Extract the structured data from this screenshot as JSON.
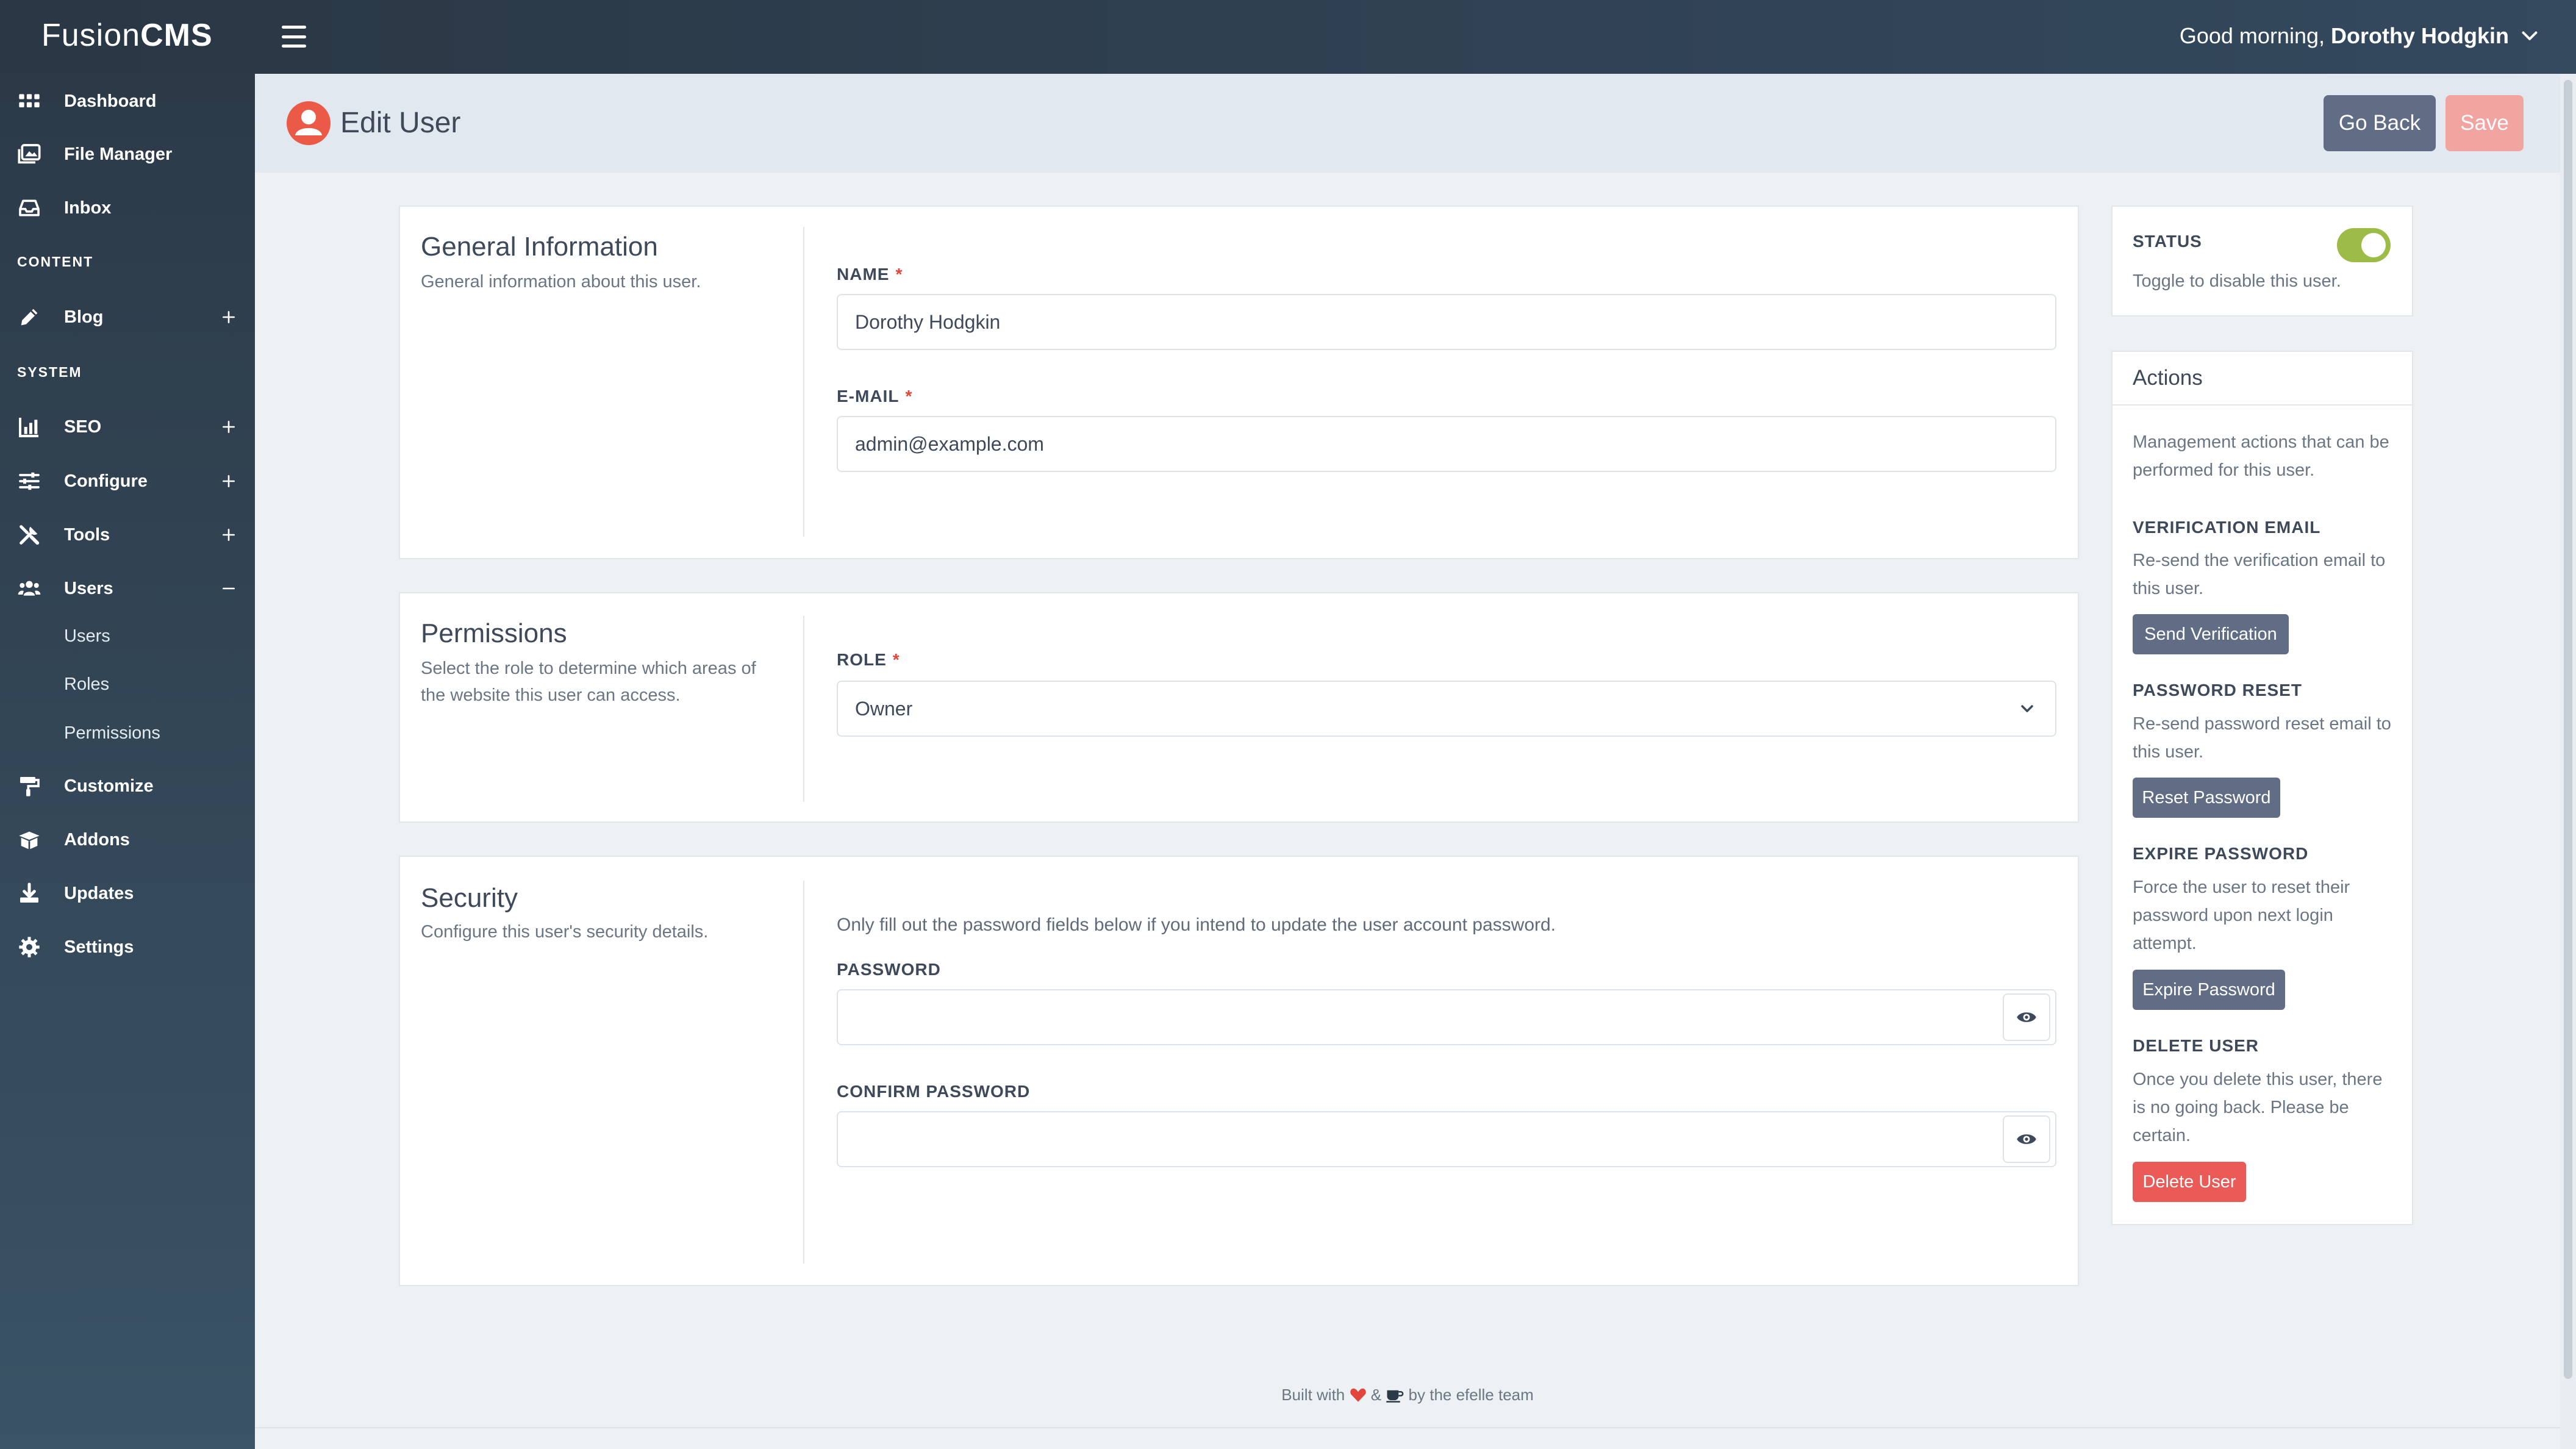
{
  "app": {
    "brand_regular": "Fusion",
    "brand_bold": "CMS",
    "greeting_prefix": "Good morning,",
    "user_name": "Dorothy Hodgkin"
  },
  "sidebar": {
    "items": [
      {
        "label": "Dashboard",
        "icon": "grid-icon"
      },
      {
        "label": "File Manager",
        "icon": "images-icon"
      },
      {
        "label": "Inbox",
        "icon": "inbox-icon"
      }
    ],
    "section_content": "CONTENT",
    "content_items": [
      {
        "label": "Blog",
        "icon": "pencil-icon"
      }
    ],
    "section_system": "SYSTEM",
    "system_items": [
      {
        "label": "SEO",
        "icon": "chart-icon"
      },
      {
        "label": "Configure",
        "icon": "sliders-icon"
      },
      {
        "label": "Tools",
        "icon": "tools-icon"
      },
      {
        "label": "Users",
        "icon": "users-icon"
      }
    ],
    "users_sub": [
      "Users",
      "Roles",
      "Permissions"
    ],
    "bottom_items": [
      {
        "label": "Customize",
        "icon": "paint-roller-icon"
      },
      {
        "label": "Addons",
        "icon": "box-icon"
      },
      {
        "label": "Updates",
        "icon": "download-icon"
      },
      {
        "label": "Settings",
        "icon": "gear-icon"
      }
    ]
  },
  "header": {
    "title": "Edit User",
    "go_back": "Go Back",
    "save": "Save"
  },
  "general": {
    "title": "General Information",
    "desc": "General information about this user.",
    "name_label": "NAME",
    "name_value": "Dorothy Hodgkin",
    "email_label": "E-MAIL",
    "email_value": "admin@example.com",
    "required_mark": "*"
  },
  "permissions": {
    "title": "Permissions",
    "desc": "Select the role to determine which areas of the website this user can access.",
    "role_label": "ROLE",
    "role_value": "Owner"
  },
  "security": {
    "title": "Security",
    "desc": "Configure this user's security details.",
    "notice": "Only fill out the password fields below if you intend to update the user account password.",
    "password_label": "PASSWORD",
    "confirm_label": "CONFIRM PASSWORD"
  },
  "status": {
    "label": "STATUS",
    "desc": "Toggle to disable this user.",
    "enabled": true
  },
  "actions": {
    "title": "Actions",
    "desc": "Management actions that can be performed for this user.",
    "verification_label": "VERIFICATION EMAIL",
    "verification_desc": "Re-send the verification email to this user.",
    "verification_btn": "Send Verification",
    "reset_label": "PASSWORD RESET",
    "reset_desc": "Re-send password reset email to this user.",
    "reset_btn": "Reset Password",
    "expire_label": "EXPIRE PASSWORD",
    "expire_desc": "Force the user to reset their password upon next login attempt.",
    "expire_btn": "Expire Password",
    "delete_label": "DELETE USER",
    "delete_desc": "Once you delete this user, there is no going back. Please be certain.",
    "delete_btn": "Delete User"
  },
  "footer": {
    "built_with": "Built with",
    "and": "&",
    "by": "by the efelle team"
  },
  "colors": {
    "accent_green": "#9dbb47",
    "danger": "#ea5a57",
    "primary_button": "#616c85",
    "sidebar": "#2c3a48"
  }
}
